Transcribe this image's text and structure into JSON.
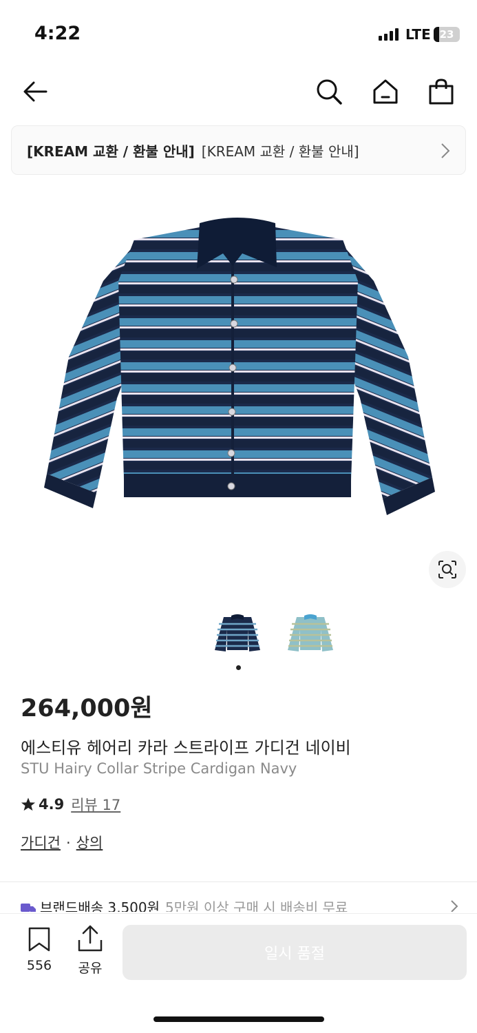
{
  "status_bar": {
    "time": "4:22",
    "network": "LTE",
    "battery": "23"
  },
  "notice": {
    "title_bold": "[KREAM 교환 / 환불 안내]",
    "title": "[KREAM 교환 / 환불 안내]"
  },
  "product": {
    "price": "264,000원",
    "name_ko": "에스티유 헤어리 카라 스트라이프 가디건 네이비",
    "name_en": "STU Hairy Collar Stripe Cardigan Navy",
    "rating": "4.9",
    "reviews": "리뷰 17",
    "categories": [
      "가디건",
      "상의"
    ],
    "category_sep": "·"
  },
  "shipping": {
    "main": "브랜드배송 3,500원",
    "sub": "5만원 이상 구매 시 배송비 무료"
  },
  "bottom": {
    "bookmark_count": "556",
    "share_label": "공유",
    "soldout_label": "일시 품절"
  },
  "icons": [
    "back-arrow-icon",
    "search-icon",
    "home-icon",
    "shopping-bag-icon",
    "chevron-right-icon",
    "lens-search-icon",
    "star-icon",
    "truck-icon",
    "bookmark-icon",
    "share-icon"
  ],
  "colors": {
    "navy": "#1b2a4a",
    "sky": "#4a90b8",
    "soldout_bg": "#ebebeb",
    "truck": "#6a5acd"
  }
}
